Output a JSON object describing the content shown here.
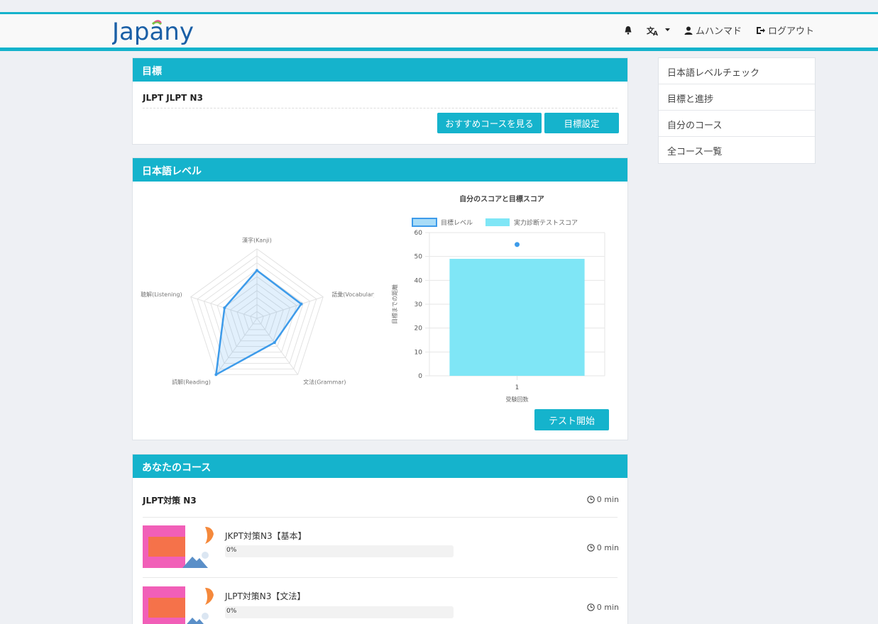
{
  "header": {
    "logo": "Japany",
    "nav": {
      "user": "ムハンマド",
      "logout": "ログアウト"
    }
  },
  "goal": {
    "title": "目標",
    "text": "JLPT JLPT N3",
    "btn_recommend": "おすすめコースを見る",
    "btn_set": "目標設定"
  },
  "level": {
    "title": "日本語レベル",
    "radar": {
      "axes": [
        "漢字(Kanji)",
        "語彙(Vocabulary)",
        "文法(Grammar)",
        "読解(Reading)",
        "聴解(Listening)"
      ],
      "values": [
        0.69,
        0.67,
        0.43,
        1.0,
        0.49
      ]
    },
    "btn_test": "テスト開始"
  },
  "chart_data": {
    "type": "bar",
    "title": "自分のスコアと目標スコア",
    "legend": [
      "目標レベル",
      "実力診断テストスコア"
    ],
    "categories": [
      "1"
    ],
    "xlabel": "受験回数",
    "ylabel": "目標までの距離",
    "ylim": [
      0,
      60
    ],
    "yticks": [
      0,
      10,
      20,
      30,
      40,
      50,
      60
    ],
    "series": [
      {
        "name": "目標レベル",
        "type": "point",
        "values": [
          55
        ]
      },
      {
        "name": "実力診断テストスコア",
        "type": "bar",
        "values": [
          49
        ]
      }
    ]
  },
  "courses": {
    "title": "あなたのコース",
    "group": {
      "name": "JLPT対策 N3",
      "time": "0 min"
    },
    "items": [
      {
        "name": "JKPT対策N3【基本】",
        "progress": "0%",
        "progress_value": 0,
        "time": "0 min"
      },
      {
        "name": "JLPT対策N3【文法】",
        "progress": "0%",
        "progress_value": 0,
        "time": "0 min"
      }
    ]
  },
  "sidebar": {
    "items": [
      {
        "label": "日本語レベルチェック"
      },
      {
        "label": "目標と進捗"
      },
      {
        "label": "自分のコース"
      },
      {
        "label": "全コース一覧"
      }
    ]
  },
  "colors": {
    "accent": "#15b3cc",
    "bar": "#7fe6f6",
    "line": "#3d9bea"
  }
}
